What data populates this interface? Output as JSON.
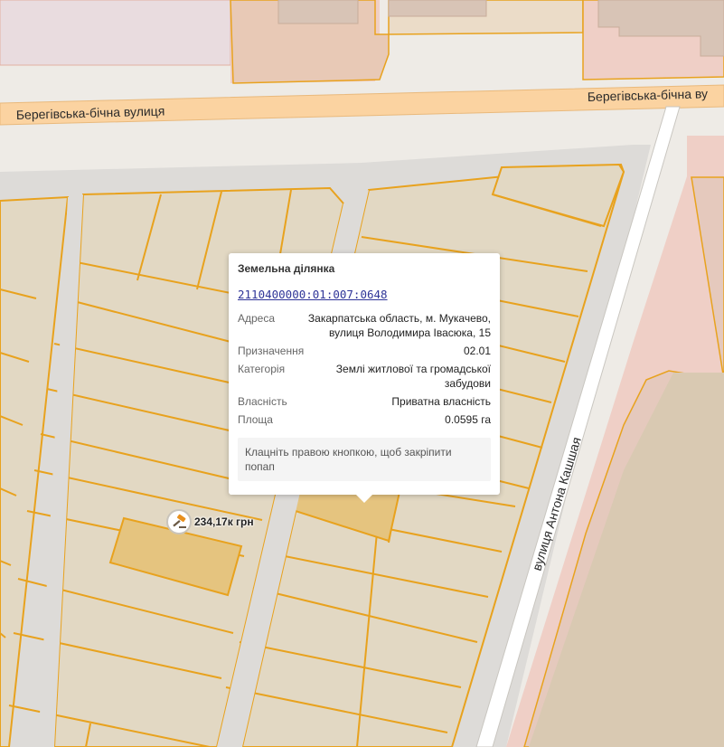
{
  "map": {
    "streets": {
      "berehivska_left": "Берегівська-бічна вулиця",
      "berehivska_right": "Берегівська-бічна ву",
      "antona_kashshaia": "вулиця Антона Кашшая"
    },
    "auction_marker": {
      "icon": "gavel-icon",
      "price": "234,17к грн"
    },
    "colors": {
      "parcel_fill": "#e2d8c3",
      "parcel_outline": "#e8a21e",
      "selected_parcel": "#e5c47f",
      "road_fill": "#fbd3a1",
      "commercial_area": "#efcfc6",
      "residential_area": "#e9dcdf"
    }
  },
  "popup": {
    "title": "Земельна ділянка",
    "cadastral_number": "2110400000:01:007:0648",
    "properties": [
      {
        "key": "Адреса",
        "value": "Закарпатська область, м. Мукачево, вулиця Володимира Івасюка, 15"
      },
      {
        "key": "Призначення",
        "value": "02.01"
      },
      {
        "key": "Категорія",
        "value": "Землі житлової та громадської забудови"
      },
      {
        "key": "Власність",
        "value": "Приватна власність"
      },
      {
        "key": "Площа",
        "value": "0.0595 га"
      }
    ],
    "hint": "Клацніть правою кнопкою, щоб закріпити попап"
  }
}
